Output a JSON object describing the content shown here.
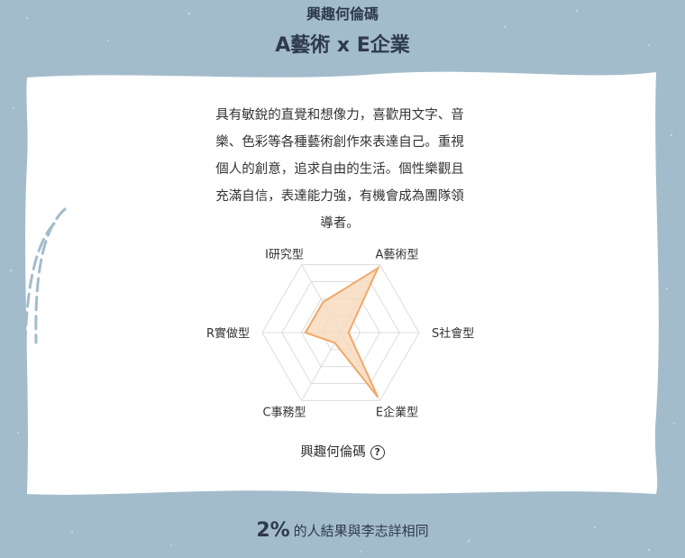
{
  "header": {
    "subtitle": "興趣何倫碼",
    "title": "A藝術 x E企業"
  },
  "description_lines": [
    "具有敏銳的直覺和想像力，喜歡用文字、音",
    "樂、色彩等各種藝術創作來表達自己。重視",
    "個人的創意，追求自由的生活。個性樂觀且",
    "充滿自信，表達能力強，有機會成為團隊領",
    "導者。"
  ],
  "chart_data": {
    "type": "radar",
    "axes": [
      "A藝術型",
      "S社會型",
      "E企業型",
      "C事務型",
      "R實做型",
      "I研究型"
    ],
    "values": [
      0.95,
      0.1,
      0.95,
      0.15,
      0.45,
      0.45
    ],
    "range": [
      0,
      1
    ],
    "rings": 4,
    "series_color": "#f0a868",
    "series_fill": "#f8d8bc"
  },
  "caption": {
    "label": "興趣何倫碼",
    "help_icon": "help-circle-icon"
  },
  "footer": {
    "percent": "2%",
    "text": "的人結果與李志詳相同"
  },
  "colors": {
    "background": "#a3bccc",
    "card": "#ffffff",
    "title": "#2e3a4d"
  }
}
